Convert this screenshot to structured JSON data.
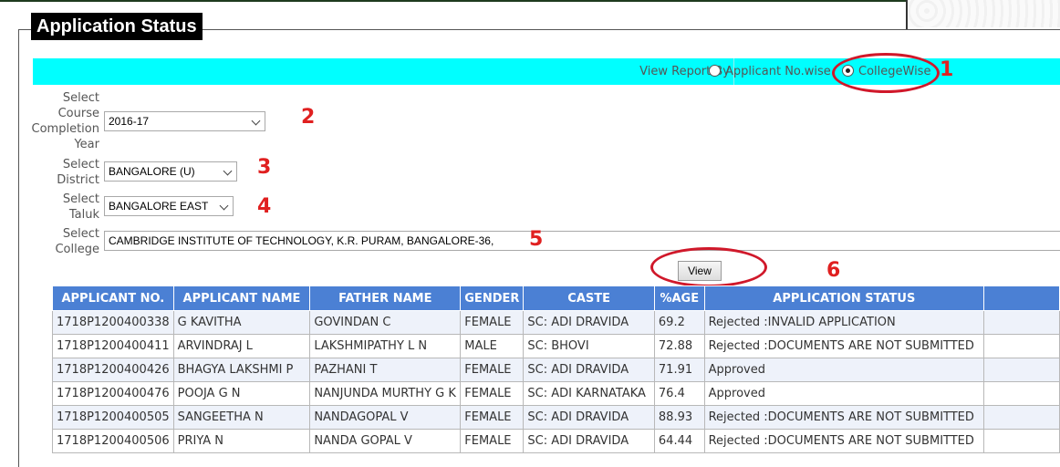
{
  "page": {
    "title": "Application Status"
  },
  "report": {
    "label": "View Report By",
    "options": [
      {
        "label": "Applicant No.wise",
        "selected": false
      },
      {
        "label": "CollegeWise",
        "selected": true
      }
    ]
  },
  "filters": {
    "year": {
      "label": "Select\nCourse\nCompletion\nYear",
      "value": "2016-17"
    },
    "district": {
      "label": "Select\nDistrict",
      "value": "BANGALORE (U)"
    },
    "taluk": {
      "label": "Select\nTaluk",
      "value": "BANGALORE EAST"
    },
    "college": {
      "label": "Select\nCollege",
      "value": "CAMBRIDGE INSTITUTE OF TECHNOLOGY, K.R. PURAM, BANGALORE-36,"
    }
  },
  "view_button": "View",
  "annotations": [
    "1",
    "2",
    "3",
    "4",
    "5",
    "6"
  ],
  "colors": {
    "accent_bar": "#00ffff",
    "table_header": "#4b80d4",
    "annotation": "#d0182a"
  },
  "table": {
    "headers": [
      "APPLICANT NO.",
      "APPLICANT NAME",
      "FATHER NAME",
      "GENDER",
      "CASTE",
      "%AGE",
      "APPLICATION STATUS",
      ""
    ],
    "rows": [
      [
        "1718P1200400338",
        "G KAVITHA",
        "GOVINDAN C",
        "FEMALE",
        "SC: ADI DRAVIDA",
        "69.2",
        "Rejected :INVALID APPLICATION",
        ""
      ],
      [
        "1718P1200400411",
        "ARVINDRAJ L",
        "LAKSHMIPATHY L N",
        "MALE",
        "SC: BHOVI",
        "72.88",
        "Rejected :DOCUMENTS ARE NOT SUBMITTED",
        ""
      ],
      [
        "1718P1200400426",
        "BHAGYA LAKSHMI P",
        "PAZHANI T",
        "FEMALE",
        "SC: ADI DRAVIDA",
        "71.91",
        "Approved",
        ""
      ],
      [
        "1718P1200400476",
        "POOJA G N",
        "NANJUNDA MURTHY G K",
        "FEMALE",
        "SC: ADI KARNATAKA",
        "76.4",
        "Approved",
        ""
      ],
      [
        "1718P1200400505",
        "SANGEETHA N",
        "NANDAGOPAL V",
        "FEMALE",
        "SC: ADI DRAVIDA",
        "88.93",
        "Rejected :DOCUMENTS ARE NOT SUBMITTED",
        ""
      ],
      [
        "1718P1200400506",
        "PRIYA N",
        "NANDA GOPAL V",
        "FEMALE",
        "SC: ADI DRAVIDA",
        "64.44",
        "Rejected :DOCUMENTS ARE NOT SUBMITTED",
        ""
      ]
    ]
  }
}
